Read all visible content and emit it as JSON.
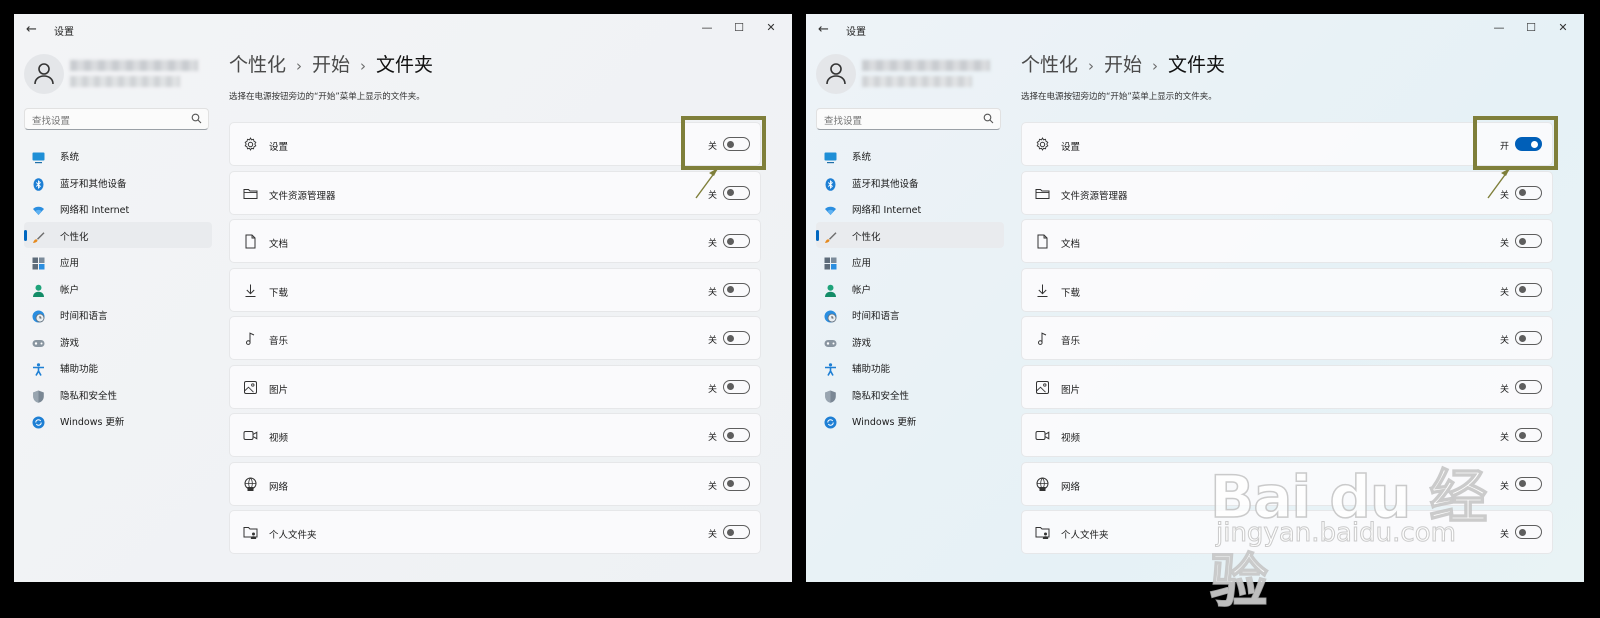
{
  "app_title": "设置",
  "window_controls": {
    "minimize": "—",
    "maximize": "☐",
    "close": "✕"
  },
  "search": {
    "placeholder": "查找设置"
  },
  "nav": [
    {
      "label": "系统",
      "icon": "monitor-icon"
    },
    {
      "label": "蓝牙和其他设备",
      "icon": "bluetooth-icon"
    },
    {
      "label": "网络和 Internet",
      "icon": "wifi-icon"
    },
    {
      "label": "个性化",
      "icon": "brush-icon",
      "active": true
    },
    {
      "label": "应用",
      "icon": "apps-icon"
    },
    {
      "label": "帐户",
      "icon": "person-icon"
    },
    {
      "label": "时间和语言",
      "icon": "globe-clock-icon"
    },
    {
      "label": "游戏",
      "icon": "gamepad-icon"
    },
    {
      "label": "辅助功能",
      "icon": "accessibility-icon"
    },
    {
      "label": "隐私和安全性",
      "icon": "shield-icon"
    },
    {
      "label": "Windows 更新",
      "icon": "refresh-icon"
    }
  ],
  "breadcrumb": {
    "level1": "个性化",
    "level2": "开始",
    "current": "文件夹",
    "separator": "›"
  },
  "description": "选择在电源按钮旁边的“开始”菜单上显示的文件夹。",
  "state_labels": {
    "on": "开",
    "off": "关"
  },
  "windows": [
    {
      "id": "left",
      "rows": [
        {
          "label": "设置",
          "icon": "gear-icon",
          "on": false
        },
        {
          "label": "文件资源管理器",
          "icon": "folder-icon",
          "on": false
        },
        {
          "label": "文档",
          "icon": "document-icon",
          "on": false
        },
        {
          "label": "下载",
          "icon": "download-icon",
          "on": false
        },
        {
          "label": "音乐",
          "icon": "music-icon",
          "on": false
        },
        {
          "label": "图片",
          "icon": "picture-icon",
          "on": false
        },
        {
          "label": "视频",
          "icon": "video-icon",
          "on": false
        },
        {
          "label": "网络",
          "icon": "network-globe-icon",
          "on": false
        },
        {
          "label": "个人文件夹",
          "icon": "personal-folder-icon",
          "on": false
        }
      ]
    },
    {
      "id": "right",
      "rows": [
        {
          "label": "设置",
          "icon": "gear-icon",
          "on": true
        },
        {
          "label": "文件资源管理器",
          "icon": "folder-icon",
          "on": false
        },
        {
          "label": "文档",
          "icon": "document-icon",
          "on": false
        },
        {
          "label": "下载",
          "icon": "download-icon",
          "on": false
        },
        {
          "label": "音乐",
          "icon": "music-icon",
          "on": false
        },
        {
          "label": "图片",
          "icon": "picture-icon",
          "on": false
        },
        {
          "label": "视频",
          "icon": "video-icon",
          "on": false
        },
        {
          "label": "网络",
          "icon": "network-globe-icon",
          "on": false
        },
        {
          "label": "个人文件夹",
          "icon": "personal-folder-icon",
          "on": false
        }
      ]
    }
  ],
  "annotation_color": "#7f7f3a",
  "accent_color": "#005fb8",
  "watermark": {
    "logo": "Bai du 经验",
    "url": "jingyan.baidu.com"
  }
}
